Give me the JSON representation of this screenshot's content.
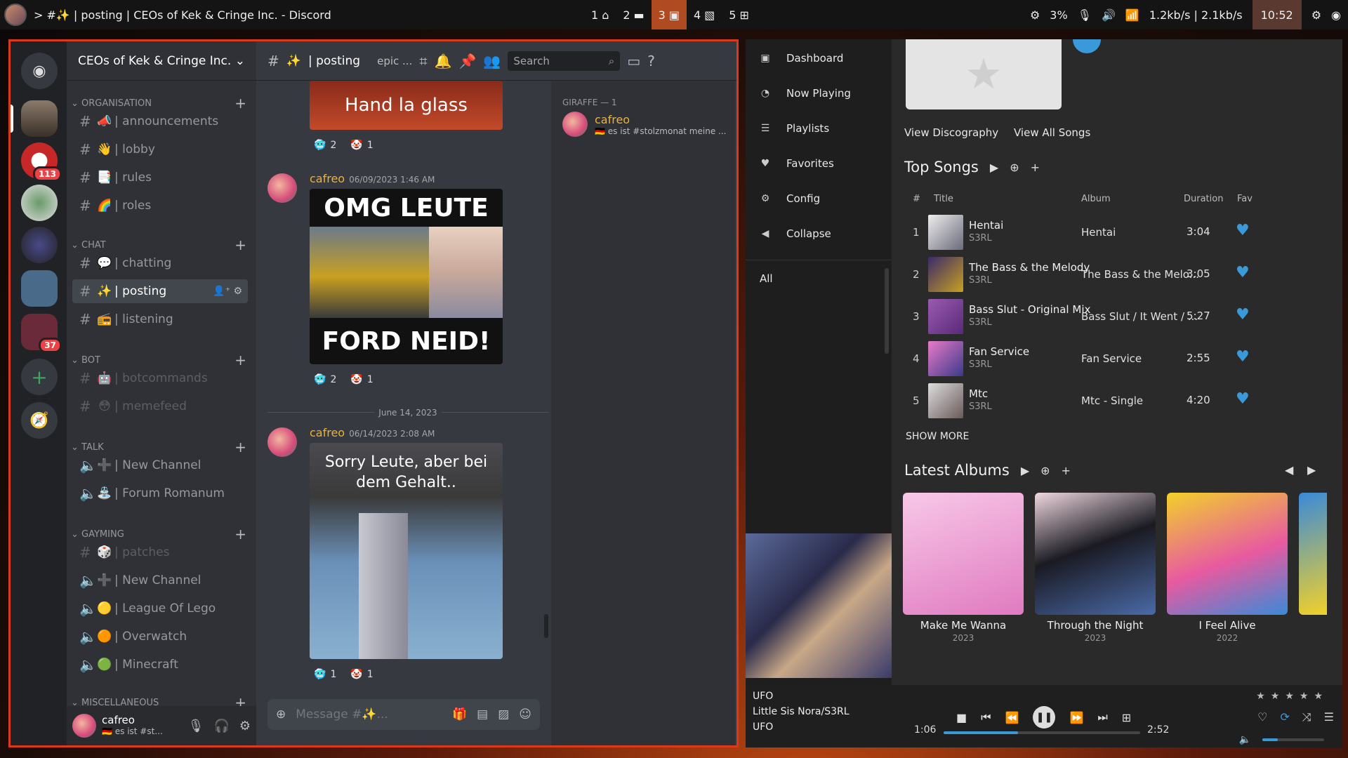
{
  "topbar": {
    "title": "> #✨ | posting | CEOs of Kek & Cringe Inc. - Discord",
    "workspaces": [
      {
        "num": "1",
        "glyph": "⌂"
      },
      {
        "num": "2",
        "glyph": "▬"
      },
      {
        "num": "3",
        "glyph": "▣"
      },
      {
        "num": "4",
        "glyph": "▧"
      },
      {
        "num": "5",
        "glyph": "⊞"
      }
    ],
    "cpu": "3%",
    "net": "1.2kb/s | 2.1kb/s",
    "clock": "10:52"
  },
  "discord": {
    "server_name": "CEOs of Kek & Cringe Inc.",
    "guild_badges": [
      "113",
      "37"
    ],
    "categories": {
      "organisation": "ORGANISATION",
      "chat": "CHAT",
      "bot": "BOT",
      "talk": "TALK",
      "gayming": "GAYMING",
      "misc": "MISCELLANEOUS"
    },
    "channels": [
      {
        "emoji": "📣",
        "name": "| announcements"
      },
      {
        "emoji": "👋",
        "name": "| lobby"
      },
      {
        "emoji": "📑",
        "name": "| rules"
      },
      {
        "emoji": "🌈",
        "name": "| roles"
      },
      {
        "emoji": "💬",
        "name": "| chatting"
      },
      {
        "emoji": "✨",
        "name": "| posting"
      },
      {
        "emoji": "📻",
        "name": "| listening"
      },
      {
        "emoji": "🤖",
        "name": "| botcommands"
      },
      {
        "emoji": "😳",
        "name": "| memefeed"
      },
      {
        "emoji": "➕",
        "name": "| New Channel"
      },
      {
        "emoji": "⛲",
        "name": "| Forum Romanum"
      },
      {
        "emoji": "🎲",
        "name": "| patches"
      },
      {
        "emoji": "➕",
        "name": "| New Channel"
      },
      {
        "emoji": "🟡",
        "name": "| League Of Lego"
      },
      {
        "emoji": "🟠",
        "name": "| Overwatch"
      },
      {
        "emoji": "🟢",
        "name": "| Minecraft"
      }
    ],
    "user": {
      "name": "cafreo",
      "status": "🇩🇪 es ist #st..."
    },
    "header": {
      "channel": "posting",
      "topic": "epic ...",
      "search_placeholder": "Search"
    },
    "messages": [
      {
        "author": "cafreo",
        "timestamp": "06/09/2023 1:46 AM",
        "img_top": "OMG LEUTE",
        "img_bottom": "FORD NEID!"
      },
      {
        "author": "cafreo",
        "timestamp": "06/14/2023 2:08 AM",
        "img_text": "Sorry Leute, aber bei dem Gehalt.."
      }
    ],
    "top_image_text": "Hand la glass",
    "reactions": [
      {
        "a": "2",
        "b": "1"
      },
      {
        "a": "2",
        "b": "1"
      },
      {
        "a": "1",
        "b": "1"
      }
    ],
    "date_divider": "June 14, 2023",
    "composer_placeholder": "Message #✨...",
    "members": {
      "category": "GIRAFFE — 1",
      "name": "cafreo",
      "status": "🇩🇪 es ist #stolzmonat meine ..."
    }
  },
  "music": {
    "nav": [
      {
        "icon": "dashboard-icon",
        "label": "Dashboard"
      },
      {
        "icon": "now-playing-icon",
        "label": "Now Playing"
      },
      {
        "icon": "playlists-icon",
        "label": "Playlists"
      },
      {
        "icon": "heart-icon",
        "label": "Favorites"
      },
      {
        "icon": "gear-icon",
        "label": "Config"
      },
      {
        "icon": "collapse-icon",
        "label": "Collapse"
      }
    ],
    "all_label": "All",
    "links": {
      "discography": "View Discography",
      "all_songs": "View All Songs"
    },
    "top_songs_title": "Top Songs",
    "columns": {
      "num": "#",
      "title": "Title",
      "album": "Album",
      "duration": "Duration",
      "fav": "Fav"
    },
    "songs": [
      {
        "num": "1",
        "title": "Hentai",
        "artist": "S3RL",
        "album": "Hentai",
        "duration": "3:04",
        "cover": "#7a7a8a"
      },
      {
        "num": "2",
        "title": "The Bass & the Melody",
        "artist": "S3RL",
        "album": "The Bass & the Melo...",
        "duration": "3:05",
        "cover": "#5a3a8a"
      },
      {
        "num": "3",
        "title": "Bass Slut - Original Mix",
        "artist": "S3RL",
        "album": "Bass Slut / It Went / ...",
        "duration": "5:27",
        "cover": "#7a4a9a"
      },
      {
        "num": "4",
        "title": "Fan Service",
        "artist": "S3RL",
        "album": "Fan Service",
        "duration": "2:55",
        "cover": "#c85aa0"
      },
      {
        "num": "5",
        "title": "Mtc",
        "artist": "S3RL",
        "album": "Mtc - Single",
        "duration": "4:20",
        "cover": "#aaaaaa"
      }
    ],
    "show_more": "SHOW MORE",
    "latest_albums_title": "Latest Albums",
    "albums": [
      {
        "name": "Make Me Wanna",
        "year": "2023",
        "color": "#f4a8d4"
      },
      {
        "name": "Through the Night",
        "year": "2023",
        "color": "#1a1a22"
      },
      {
        "name": "I Feel Alive",
        "year": "2022",
        "color": "#f2d12a"
      }
    ],
    "player": {
      "title": "UFO",
      "artist": "Little Sis Nora/S3RL",
      "album": "UFO",
      "elapsed": "1:06",
      "total": "2:52",
      "progress": 0.38,
      "volume": 0.25,
      "accent": "#3a9ad9"
    }
  }
}
